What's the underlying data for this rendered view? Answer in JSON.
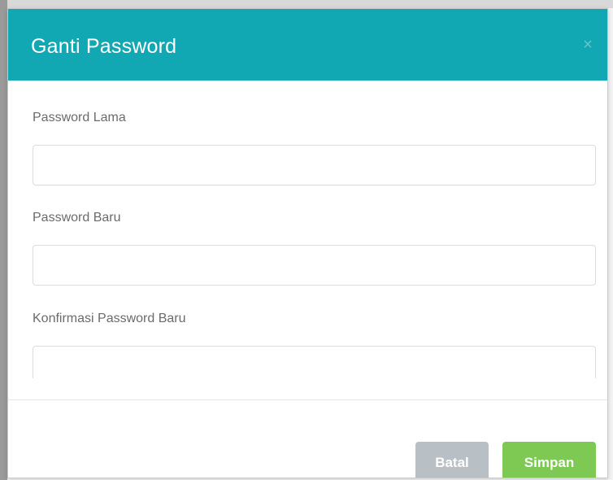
{
  "dialog": {
    "title": "Ganti Password",
    "close_label": "×"
  },
  "form": {
    "fields": [
      {
        "label": "Password Lama",
        "value": "",
        "placeholder": ""
      },
      {
        "label": "Password Baru",
        "value": "",
        "placeholder": ""
      },
      {
        "label": "Konfirmasi Password Baru",
        "value": "",
        "placeholder": ""
      }
    ]
  },
  "footer": {
    "cancel_label": "Batal",
    "save_label": "Simpan"
  },
  "colors": {
    "header": "#12a8b3",
    "cancel_button": "#b9c0c5",
    "save_button": "#7dc953"
  }
}
